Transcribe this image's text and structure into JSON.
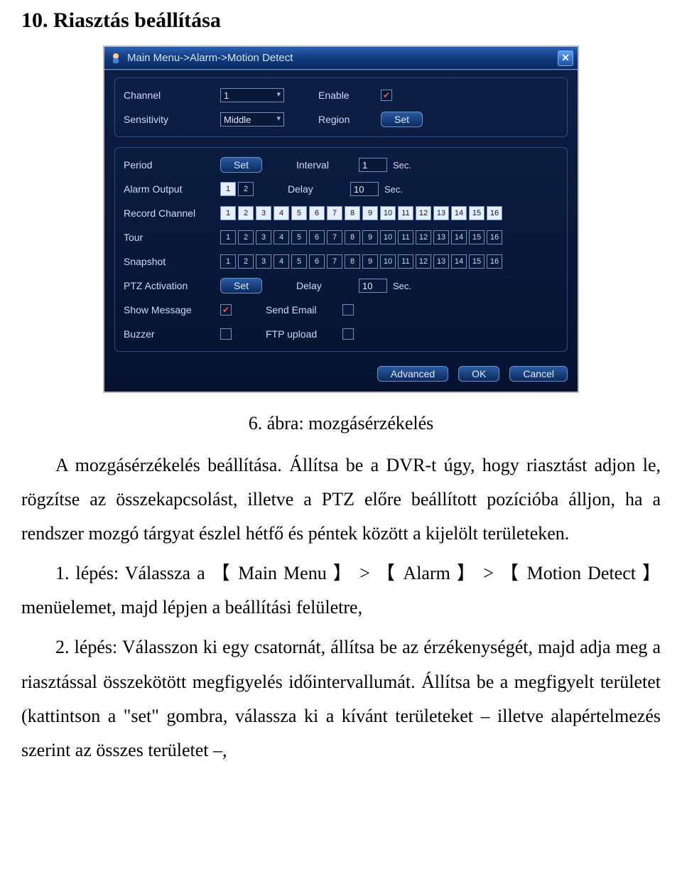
{
  "doc": {
    "section_title": "10. Riasztás beállítása",
    "caption": "6. ábra: mozgásérzékelés",
    "p1": "A mozgásérzékelés beállítása. Állítsa be a DVR-t úgy, hogy riasztást adjon le, rögzítse az összekapcsolást, illetve a PTZ előre beállított pozícióba álljon, ha a rendszer mozgó tárgyat észlel hétfő és péntek között a kijelölt területeken.",
    "p2": "1. lépés: Válassza a 【 Main Menu 】 > 【 Alarm 】 > 【 Motion Detect 】 menüelemet, majd lépjen a beállítási felületre,",
    "p3": "2. lépés: Válasszon ki egy csatornát, állítsa be az érzékenységét, majd adja meg a riasztással összekötött megfigyelés időintervallumát. Állítsa be a megfigyelt területet (kattintson a \"set\" gombra, válassza ki a kívánt területeket – illetve alapértelmezés szerint az összes területet –,"
  },
  "dvr": {
    "title": "Main Menu->Alarm->Motion Detect",
    "labels": {
      "channel": "Channel",
      "enable": "Enable",
      "sensitivity": "Sensitivity",
      "region": "Region",
      "period": "Period",
      "interval": "Interval",
      "alarm_output": "Alarm Output",
      "delay": "Delay",
      "record_channel": "Record Channel",
      "tour": "Tour",
      "snapshot": "Snapshot",
      "ptz_activation": "PTZ Activation",
      "show_message": "Show Message",
      "send_email": "Send Email",
      "buzzer": "Buzzer",
      "ftp_upload": "FTP upload",
      "sec": "Sec."
    },
    "values": {
      "channel": "1",
      "sensitivity": "Middle",
      "interval": "1",
      "alarm_delay": "10",
      "ptz_delay": "10"
    },
    "buttons": {
      "set": "Set",
      "advanced": "Advanced",
      "ok": "OK",
      "cancel": "Cancel"
    },
    "checks": {
      "enable": true,
      "show_message": true,
      "send_email": false,
      "buzzer": false,
      "ftp_upload": false
    },
    "alarm_output": {
      "count": 2,
      "selected": [
        1
      ]
    },
    "channel_grids": {
      "count": 16,
      "record_selected": [
        1,
        2,
        3,
        4,
        5,
        6,
        7,
        8,
        9,
        10,
        11,
        12,
        13,
        14,
        15,
        16
      ],
      "tour_selected": [],
      "snapshot_selected": []
    }
  }
}
